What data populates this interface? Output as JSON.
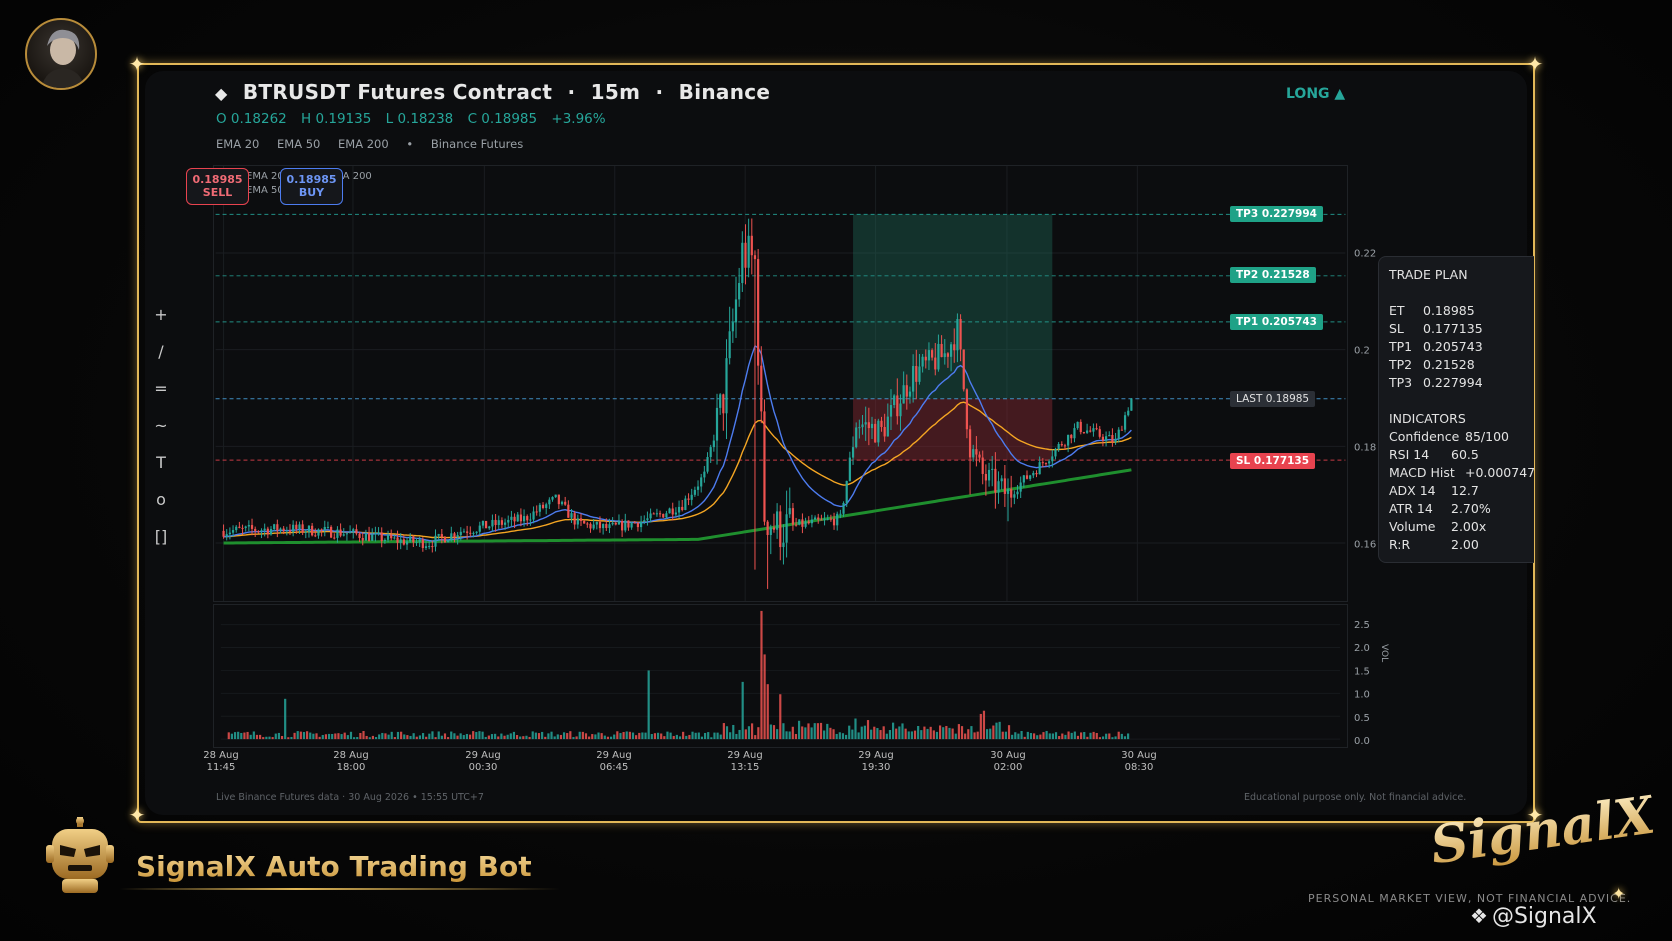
{
  "header": {
    "title_icon": "diamond-icon",
    "title_symbol": "BTRUSDT Futures Contract",
    "title_sep1": "·",
    "title_interval": "15m",
    "title_sep2": "·",
    "title_exchange": "Binance",
    "ohlc": {
      "open": "O 0.18262",
      "high": "H 0.19135",
      "low": "L 0.18238",
      "close": "C 0.18985",
      "change": "+3.96%"
    },
    "indicators": [
      "EMA 20",
      "EMA 50",
      "EMA 200",
      "•",
      "Binance Futures"
    ],
    "side": "LONG ▲"
  },
  "colors": {
    "up": "#26a69a",
    "down": "#ef5350",
    "ema20": "#4d7cf0",
    "ema50": "#f5a623",
    "ema200": "#1f8f2e",
    "gold": "#e2b858",
    "tp": "#26a69a",
    "sl": "#e8434f"
  },
  "toolbar": [
    "+",
    "/",
    "=",
    "~",
    "T",
    "o",
    "[]"
  ],
  "order_buttons": {
    "sell_price": "0.18985",
    "sell_label": "SELL",
    "buy_price": "0.18985",
    "buy_label": "BUY"
  },
  "ghost_legend": {
    "line1": "EMA 20  EMA 50  EMA 200",
    "line2": "EMA 50"
  },
  "price_levels": {
    "tp3": "TP3  0.227994",
    "tp2": "TP2  0.21528",
    "tp1": "TP1  0.205743",
    "last": "LAST  0.18985",
    "sl": "SL  0.177135"
  },
  "price_axis": {
    "ticks": [
      "0.22",
      "0.2",
      "0.18",
      "0.16"
    ],
    "exponent": "1e8"
  },
  "volume_axis": {
    "ticks": [
      "2.5",
      "2.0",
      "1.5",
      "1.0",
      "0.5",
      "0.0"
    ],
    "label": "VOL"
  },
  "time_axis": [
    {
      "date": "28 Aug",
      "time": "11:45"
    },
    {
      "date": "28 Aug",
      "time": "18:00"
    },
    {
      "date": "29 Aug",
      "time": "00:30"
    },
    {
      "date": "29 Aug",
      "time": "06:45"
    },
    {
      "date": "29 Aug",
      "time": "13:15"
    },
    {
      "date": "29 Aug",
      "time": "19:30"
    },
    {
      "date": "30 Aug",
      "time": "02:00"
    },
    {
      "date": "30 Aug",
      "time": "08:30"
    }
  ],
  "trade_plan": {
    "title": "TRADE PLAN",
    "levels": [
      {
        "k": "ET",
        "v": "0.18985"
      },
      {
        "k": "SL",
        "v": "0.177135"
      },
      {
        "k": "TP1",
        "v": "0.205743"
      },
      {
        "k": "TP2",
        "v": "0.21528"
      },
      {
        "k": "TP3",
        "v": "0.227994"
      }
    ],
    "indicators_title": "INDICATORS",
    "indicators": [
      {
        "k": "Confidence",
        "v": "85/100"
      },
      {
        "k": "RSI 14",
        "v": "60.5"
      },
      {
        "k": "MACD Hist",
        "v": "+0.000747"
      },
      {
        "k": "ADX 14",
        "v": "12.7"
      },
      {
        "k": "ATR 14",
        "v": "2.70%"
      },
      {
        "k": "Volume",
        "v": "2.00x"
      },
      {
        "k": "R:R",
        "v": "2.00"
      }
    ]
  },
  "footer": {
    "left": "Live Binance Futures data  ·  30 Aug 2026 • 15:55 UTC+7",
    "right": "Educational purpose only. Not financial advice."
  },
  "branding": {
    "bot_name": "SignalX Auto Trading Bot",
    "logo_text": "SignalX",
    "disclaimer": "PERSONAL MARKET VIEW, NOT FINANCIAL ADVICE.",
    "watermark_icon": "binance-square-icon",
    "watermark": "@SignalX"
  },
  "chart_data": {
    "type": "candlestick",
    "ylim": [
      0.148,
      0.238
    ],
    "levels": {
      "tp3": 0.227994,
      "tp2": 0.21528,
      "tp1": 0.205743,
      "entry": 0.18985,
      "sl": 0.177135
    },
    "anchors": [
      [
        0,
        0.1625
      ],
      [
        20,
        0.163
      ],
      [
        40,
        0.162
      ],
      [
        55,
        0.1605
      ],
      [
        65,
        0.16
      ],
      [
        75,
        0.1625
      ],
      [
        95,
        0.165
      ],
      [
        105,
        0.169
      ],
      [
        112,
        0.164
      ],
      [
        122,
        0.163
      ],
      [
        135,
        0.165
      ],
      [
        145,
        0.168
      ],
      [
        152,
        0.174
      ],
      [
        158,
        0.19
      ],
      [
        164,
        0.22
      ],
      [
        168,
        0.218
      ],
      [
        171,
        0.166
      ],
      [
        175,
        0.163
      ],
      [
        195,
        0.165
      ],
      [
        200,
        0.185
      ],
      [
        208,
        0.183
      ],
      [
        218,
        0.195
      ],
      [
        228,
        0.199
      ],
      [
        232,
        0.204
      ],
      [
        236,
        0.18
      ],
      [
        240,
        0.174
      ],
      [
        248,
        0.17
      ],
      [
        258,
        0.176
      ],
      [
        270,
        0.184
      ],
      [
        282,
        0.181
      ],
      [
        287,
        0.19
      ]
    ],
    "ema20_end": 0.1822,
    "ema50_end": 0.182,
    "ema200_end": 0.174,
    "volume_ylim": [
      0,
      2.8
    ],
    "volume_spikes": [
      [
        18,
        0.88
      ],
      [
        134,
        1.5
      ],
      [
        164,
        1.25
      ],
      [
        170,
        2.8
      ],
      [
        171,
        1.85
      ],
      [
        172,
        1.2
      ],
      [
        176,
        0.98
      ],
      [
        200,
        0.45
      ],
      [
        240,
        0.55
      ],
      [
        241,
        0.62
      ]
    ],
    "volume_base": 0.1
  }
}
